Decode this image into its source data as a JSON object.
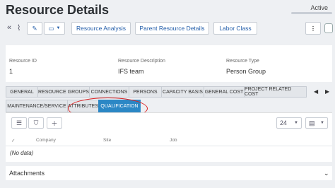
{
  "header": {
    "title": "Resource Details",
    "status": "Active"
  },
  "toolbar": {
    "buttons": [
      "Resource Analysis",
      "Parent Resource Details",
      "Labor Class"
    ],
    "more": "⋮"
  },
  "fields": [
    {
      "label": "Resource ID",
      "value": "1"
    },
    {
      "label": "Resource Description",
      "value": "IFS team"
    },
    {
      "label": "Resource Type",
      "value": "Person Group"
    }
  ],
  "tabs_row1": [
    "GENERAL",
    "RESOURCE GROUPS",
    "CONNECTIONS",
    "PERSONS",
    "CAPACITY BASIS",
    "GENERAL COST",
    "PROJECT RELATED COST"
  ],
  "tabs_row2": [
    "MAINTENANCE/SERVICE",
    "ATTRIBUTES",
    "QUALIFICATION"
  ],
  "selected_tab": "QUALIFICATION",
  "grid": {
    "page_size": "24",
    "columns": [
      "Company",
      "Site",
      "Job"
    ],
    "empty_text": "(No data)"
  },
  "attachments": {
    "label": "Attachments"
  },
  "colors": {
    "accent": "#2b87c5",
    "link": "#1e5aa8",
    "annotation": "#dd2222"
  }
}
